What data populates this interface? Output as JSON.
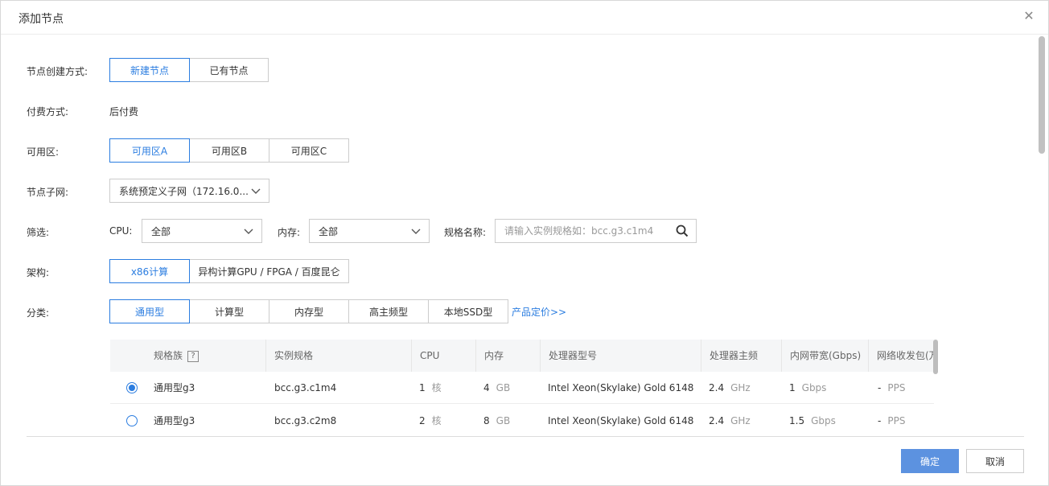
{
  "dialog": {
    "title": "添加节点",
    "close_icon": "close-icon"
  },
  "form": {
    "creation_method": {
      "label": "节点创建方式:",
      "options": [
        "新建节点",
        "已有节点"
      ],
      "selected": "新建节点"
    },
    "billing": {
      "label": "付费方式:",
      "value": "后付费"
    },
    "zone": {
      "label": "可用区:",
      "options": [
        "可用区A",
        "可用区B",
        "可用区C"
      ],
      "selected": "可用区A"
    },
    "subnet": {
      "label": "节点子网:",
      "value": "系统预定义子网（172.16.0...."
    },
    "filter": {
      "label": "筛选:",
      "cpu_label": "CPU:",
      "cpu_value": "全部",
      "memory_label": "内存:",
      "memory_value": "全部",
      "spec_label": "规格名称:",
      "spec_placeholder": "请输入实例规格如：bcc.g3.c1m4"
    },
    "arch": {
      "label": "架构:",
      "options": [
        "x86计算",
        "异构计算GPU / FPGA / 百度昆仑"
      ],
      "selected": "x86计算"
    },
    "category": {
      "label": "分类:",
      "options": [
        "通用型",
        "计算型",
        "内存型",
        "高主频型",
        "本地SSD型"
      ],
      "selected": "通用型",
      "pricing_link": "产品定价>>"
    }
  },
  "table": {
    "headers": [
      "规格族",
      "实例规格",
      "CPU",
      "内存",
      "处理器型号",
      "处理器主频",
      "内网带宽(Gbps)",
      "网络收发包(万"
    ],
    "help_mark": "?",
    "rows": [
      {
        "family": "通用型g3",
        "spec": "bcc.g3.c1m4",
        "cpu": "1",
        "cpu_unit": "核",
        "mem": "4",
        "mem_unit": "GB",
        "processor": "Intel Xeon(Skylake) Gold 6148",
        "freq": "2.4",
        "freq_unit": "GHz",
        "bandwidth": "1",
        "bw_unit": "Gbps",
        "pps": "-",
        "pps_unit": "PPS",
        "checked": true
      },
      {
        "family": "通用型g3",
        "spec": "bcc.g3.c2m8",
        "cpu": "2",
        "cpu_unit": "核",
        "mem": "8",
        "mem_unit": "GB",
        "processor": "Intel Xeon(Skylake) Gold 6148",
        "freq": "2.4",
        "freq_unit": "GHz",
        "bandwidth": "1.5",
        "bw_unit": "Gbps",
        "pps": "-",
        "pps_unit": "PPS",
        "checked": false
      }
    ]
  },
  "footer": {
    "confirm": "确定",
    "cancel": "取消"
  },
  "colors": {
    "accent": "#2b7de0",
    "primary_button": "#5c92e0"
  }
}
